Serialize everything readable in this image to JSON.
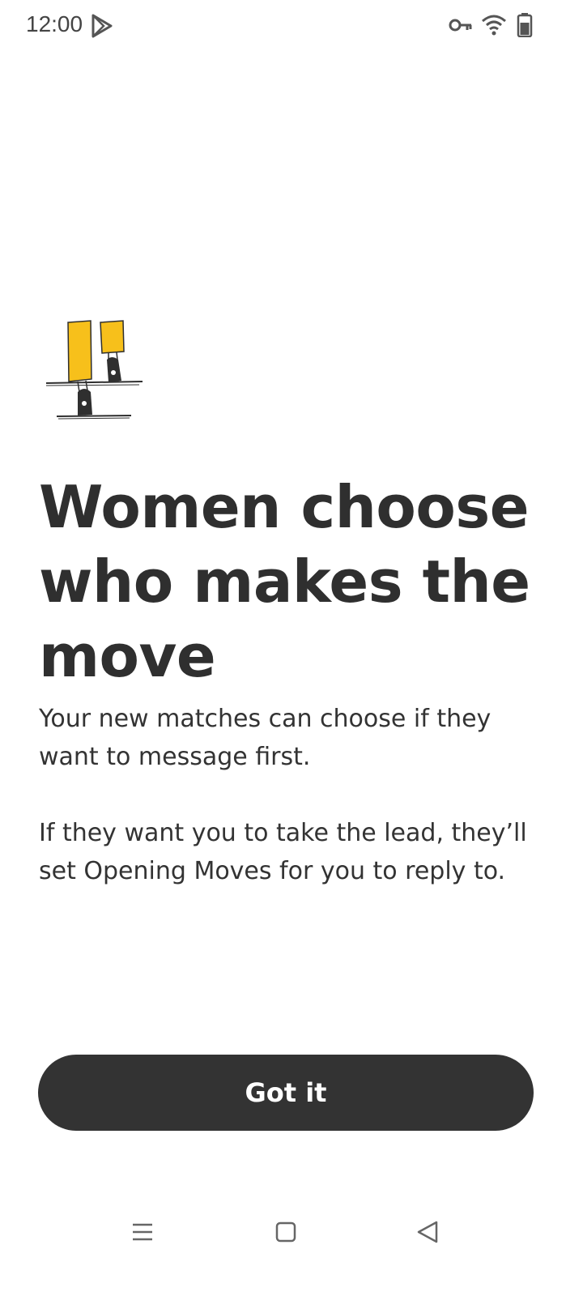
{
  "status_bar": {
    "time": "12:00",
    "icons": [
      "play-store-icon",
      "vpn-key-icon",
      "wifi-icon",
      "battery-icon"
    ]
  },
  "illustration": {
    "icon": "stairs-feet-illustration",
    "colors": {
      "accent": "#F7C01B",
      "ink": "#2f2f2f"
    }
  },
  "content": {
    "headline": "Women choose who makes the move",
    "paragraph_1": "Your new matches can choose if they want to message first.",
    "paragraph_2": "If they want you to take the lead, they’ll set Opening Moves for you to reply to."
  },
  "actions": {
    "primary_label": "Got it"
  },
  "navigation": {
    "icons": [
      "menu-icon",
      "home-icon",
      "back-icon"
    ]
  },
  "colors": {
    "button_bg": "#333333",
    "button_text": "#ffffff",
    "text": "#2f2f2f",
    "background": "#ffffff"
  }
}
